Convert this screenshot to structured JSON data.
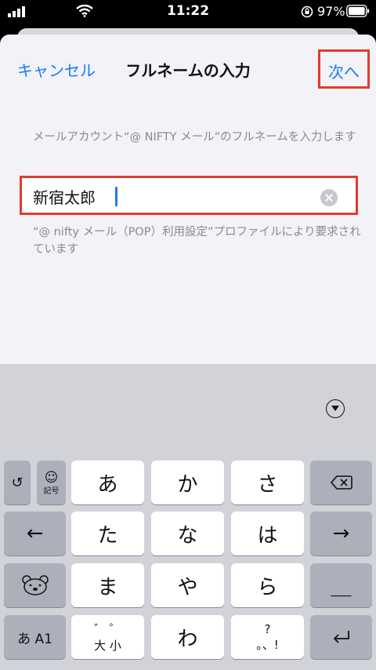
{
  "status_bar": {
    "time": "11:22",
    "battery": "97%"
  },
  "nav": {
    "cancel_label": "キャンセル",
    "title": "フルネームの入力",
    "next_label": "次へ"
  },
  "description": "メールアカウント“@ NIFTY メール”のフルネームを入力します",
  "field": {
    "value": "新宿太郎"
  },
  "note": "“@ nifty メール（POP）利用設定”プロファイルにより要求されています",
  "keyboard": {
    "undo": "↺",
    "emoji": "☺",
    "emoji_sub": "記号",
    "row1": [
      "あ",
      "か",
      "さ"
    ],
    "row2": [
      "た",
      "な",
      "は"
    ],
    "row3": [
      "ま",
      "や",
      "ら"
    ],
    "row4": [
      "わ"
    ],
    "left_arrow": "←",
    "right_arrow": "→",
    "space": "＿",
    "mode": "あ A1",
    "dakuten_top": "゛ ゜",
    "dakuten_bottom": "大 小",
    "punct_top": "?",
    "punct_bottom": "。、!",
    "return": "↵"
  }
}
